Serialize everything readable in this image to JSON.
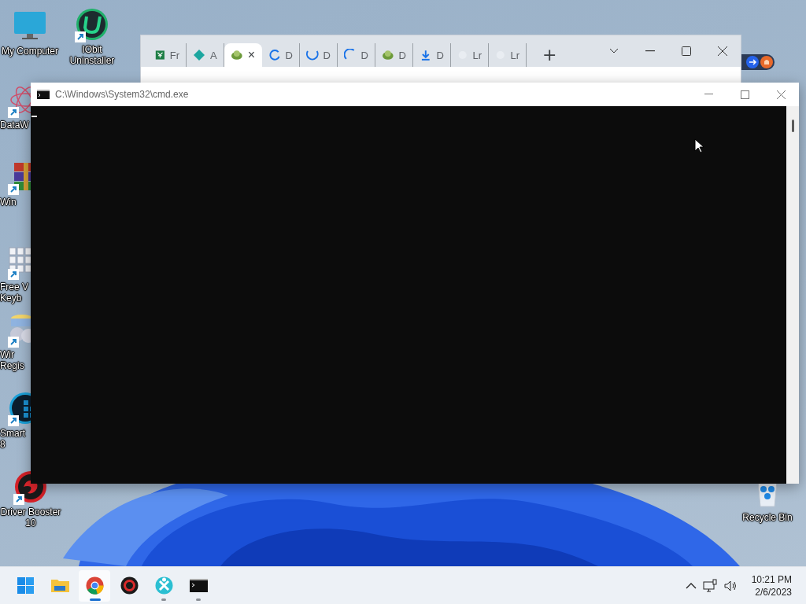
{
  "desktop_icons": [
    {
      "lines": [
        "My Computer"
      ],
      "shortcut": false
    },
    {
      "lines": [
        "IObit",
        "Uninstaller"
      ],
      "shortcut": true
    },
    {
      "lines": [
        "DataW"
      ],
      "shortcut": true
    },
    {
      "lines": [
        "Win"
      ],
      "shortcut": true
    },
    {
      "lines": [
        "Free V",
        "Keyb"
      ],
      "shortcut": true
    },
    {
      "lines": [
        "Wir",
        "Regis"
      ],
      "shortcut": true
    },
    {
      "lines": [
        "Smart",
        "8"
      ],
      "shortcut": true
    },
    {
      "lines": [
        "Driver Booster",
        "10"
      ],
      "shortcut": true
    },
    {
      "lines": [
        "Recycle Bin"
      ],
      "shortcut": false
    }
  ],
  "browser_window": {
    "tabs": [
      {
        "label": "Fr",
        "selected": false
      },
      {
        "label": "A",
        "selected": false
      },
      {
        "close": "×",
        "selected": true
      },
      {
        "label": "D",
        "selected": false
      },
      {
        "label": "D",
        "selected": false
      },
      {
        "label": "D",
        "selected": false
      },
      {
        "label": "D",
        "selected": false
      },
      {
        "label": "D",
        "selected": false
      },
      {
        "label": "Lr",
        "selected": false
      },
      {
        "label": "Lr",
        "selected": false
      }
    ],
    "new_tab": "+"
  },
  "console_window": {
    "title": "C:\\Windows\\System32\\cmd.exe"
  },
  "taskbar": {
    "apps": [
      {
        "selected": false,
        "running": false
      },
      {
        "selected": false,
        "running": false
      },
      {
        "selected": true,
        "running": true
      },
      {
        "selected": false,
        "running": false
      },
      {
        "selected": false,
        "running": true
      },
      {
        "selected": false,
        "running": true
      }
    ],
    "clock": {
      "time": "10:21 PM",
      "date": "2/6/2023"
    }
  }
}
